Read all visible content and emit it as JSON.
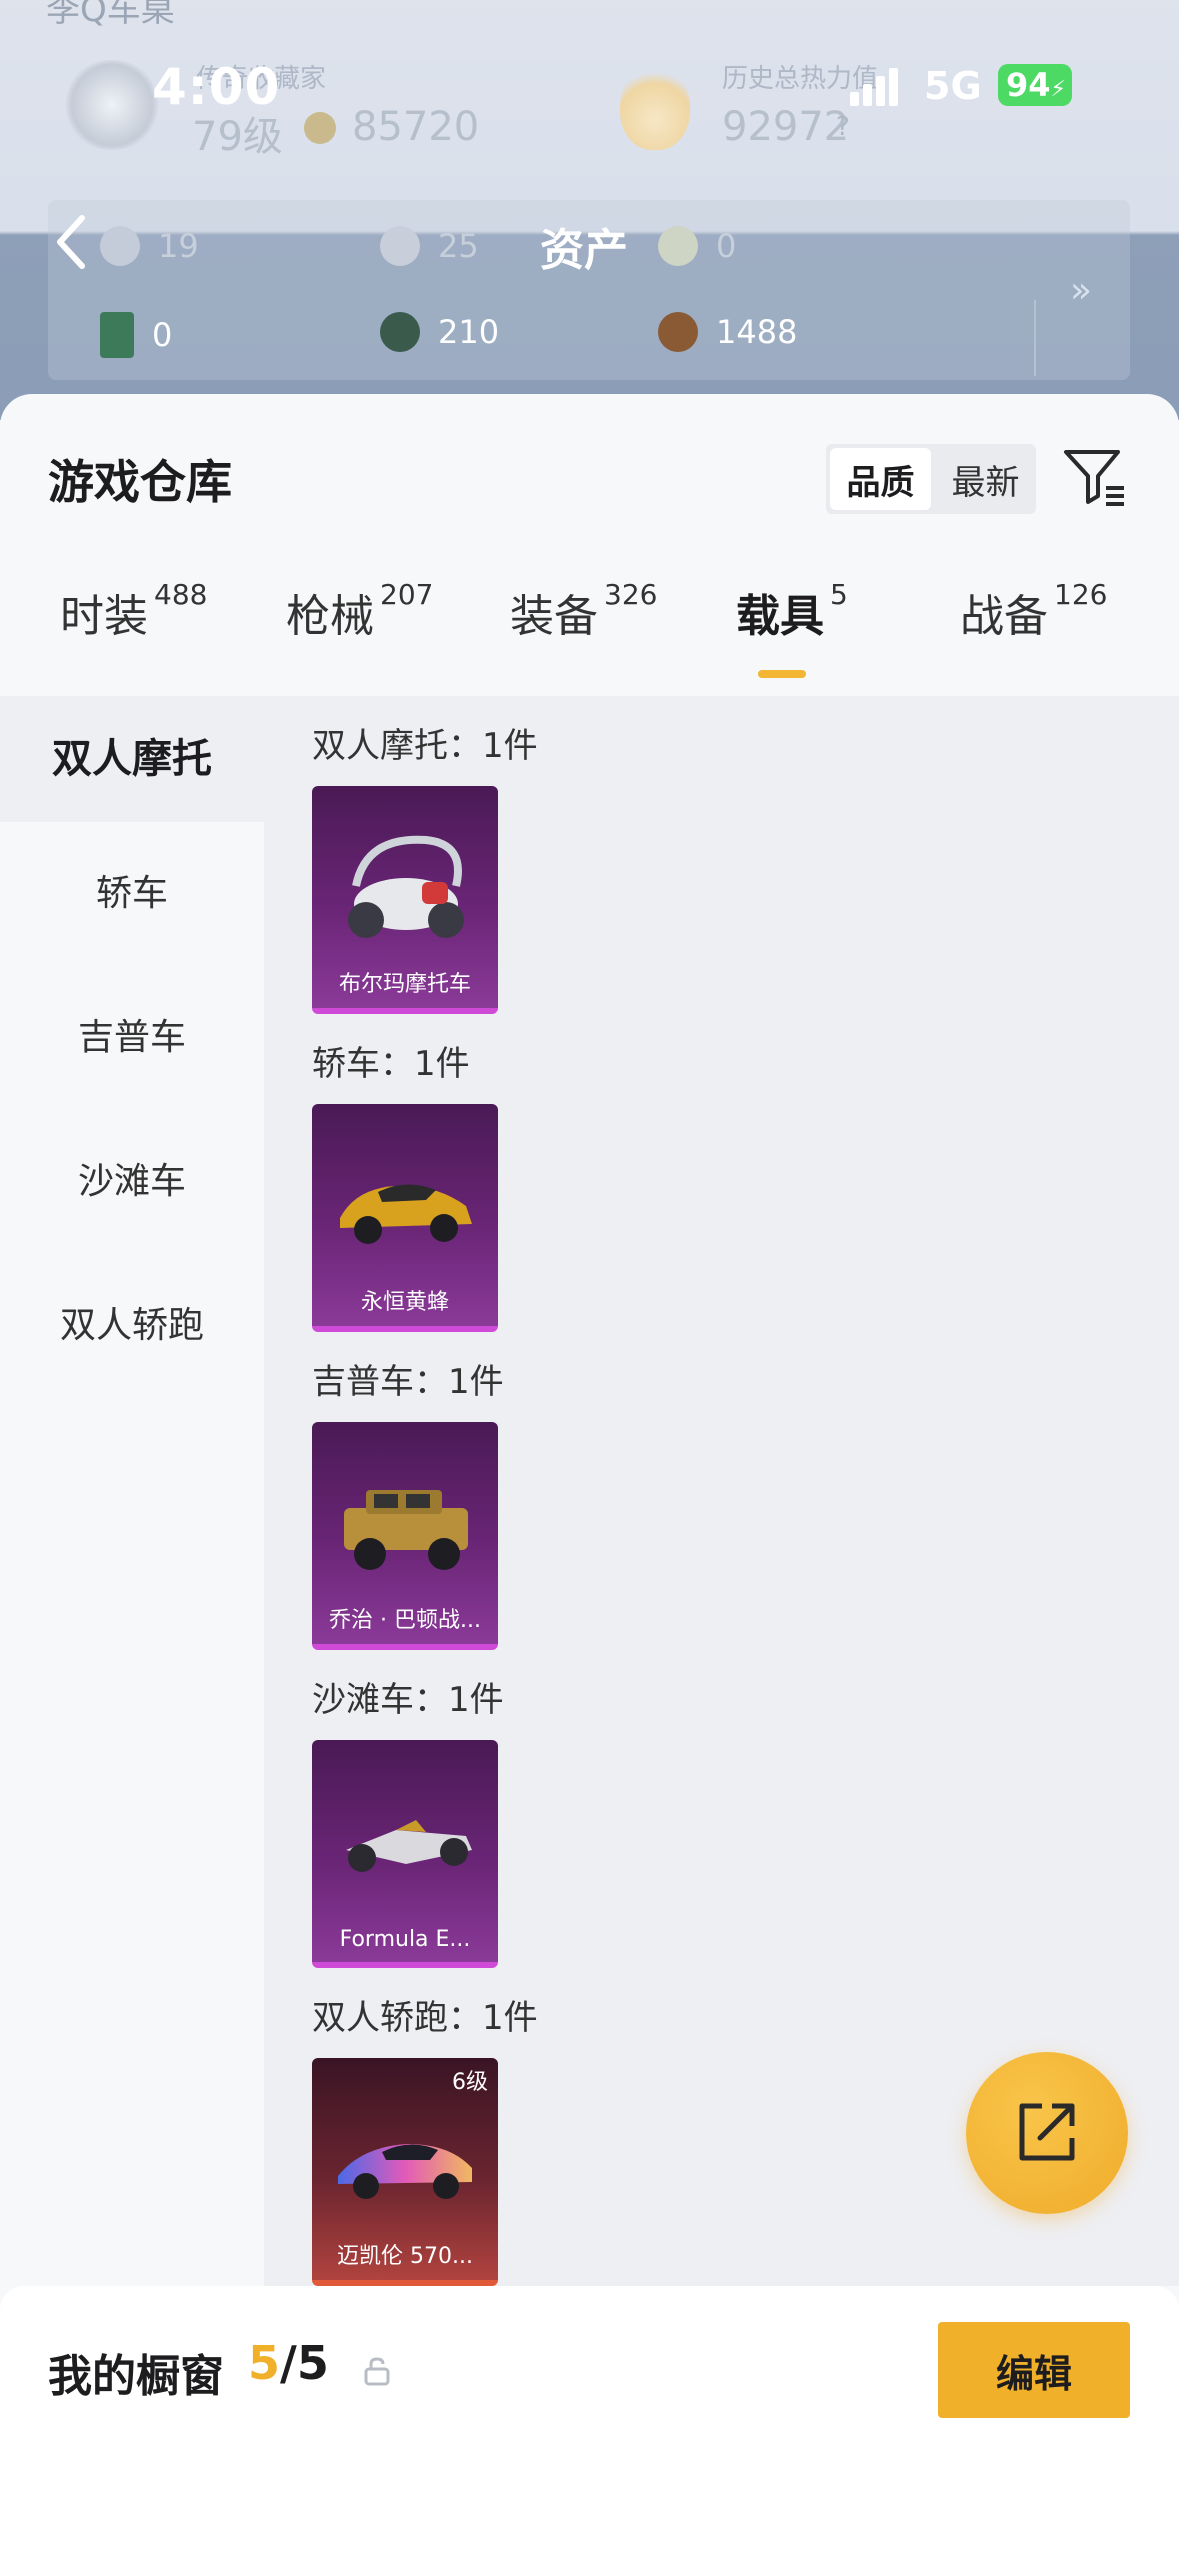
{
  "status": {
    "time": "4:00",
    "network": "5G",
    "battery": "94"
  },
  "header": {
    "clipped_title": "李Q车桌",
    "collector_label": "传奇收藏家",
    "level": "79级",
    "coins": "85720",
    "heat_label": "历史总热力值",
    "heat_value": "92972",
    "assets_title": "资产",
    "assets_row1": [
      "19",
      "25",
      "0"
    ],
    "assets_row2": [
      "0",
      "210",
      "1488"
    ]
  },
  "warehouse": {
    "title": "游戏仓库",
    "sort_options": [
      "品质",
      "最新"
    ],
    "active_sort": "品质"
  },
  "tabs": [
    {
      "label": "时装",
      "count": "488"
    },
    {
      "label": "枪械",
      "count": "207"
    },
    {
      "label": "装备",
      "count": "326"
    },
    {
      "label": "载具",
      "count": "5"
    },
    {
      "label": "战备",
      "count": "126"
    }
  ],
  "active_tab": "载具",
  "sidebar": [
    "双人摩托",
    "轿车",
    "吉普车",
    "沙滩车",
    "双人轿跑"
  ],
  "sections": [
    {
      "title": "双人摩托：1件",
      "item": "布尔玛摩托车",
      "rarity": "purple",
      "level": ""
    },
    {
      "title": "轿车：1件",
      "item": "永恒黄蜂",
      "rarity": "purple",
      "level": ""
    },
    {
      "title": "吉普车：1件",
      "item": "乔治 · 巴顿战...",
      "rarity": "purple",
      "level": ""
    },
    {
      "title": "沙滩车：1件",
      "item": "Formula E...",
      "rarity": "purple",
      "level": ""
    },
    {
      "title": "双人轿跑：1件",
      "item": "迈凯伦 570...",
      "rarity": "orange",
      "level": "6级"
    }
  ],
  "showcase": {
    "title": "我的橱窗",
    "current": "5",
    "total": "/5",
    "edit_label": "编辑"
  },
  "colors": {
    "accent": "#f0b02a",
    "purple_card": "#6a2576",
    "orange_card": "#b0433e"
  }
}
